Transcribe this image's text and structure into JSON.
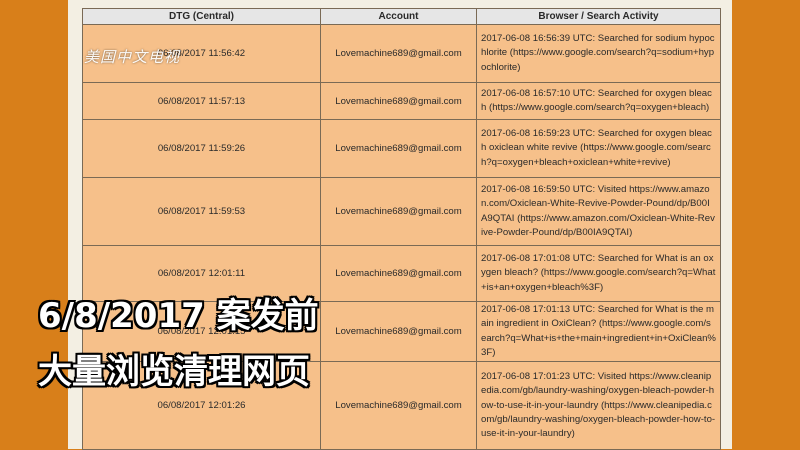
{
  "table": {
    "headers": {
      "dtg": "DTG (Central)",
      "account": "Account",
      "activity": "Browser / Search Activity"
    },
    "rows": [
      {
        "dtg": "06/08/2017 11:56:42",
        "account": "Lovemachine689@gmail.com",
        "activity": "2017-06-08 16:56:39 UTC: Searched for sodium hypochlorite (https://www.google.com/search?q=sodium+hypochlorite)"
      },
      {
        "dtg": "06/08/2017 11:57:13",
        "account": "Lovemachine689@gmail.com",
        "activity": "2017-06-08 16:57:10 UTC: Searched for oxygen bleach (https://www.google.com/search?q=oxygen+bleach)"
      },
      {
        "dtg": "06/08/2017 11:59:26",
        "account": "Lovemachine689@gmail.com",
        "activity": "2017-06-08 16:59:23 UTC: Searched for oxygen bleach oxiclean white revive (https://www.google.com/search?q=oxygen+bleach+oxiclean+white+revive)"
      },
      {
        "dtg": "06/08/2017 11:59:53",
        "account": "Lovemachine689@gmail.com",
        "activity": "2017-06-08 16:59:50 UTC: Visited https://www.amazon.com/Oxiclean-White-Revive-Powder-Pound/dp/B00IA9QTAI (https://www.amazon.com/Oxiclean-White-Revive-Powder-Pound/dp/B00IA9QTAI)"
      },
      {
        "dtg": "06/08/2017 12:01:11",
        "account": "Lovemachine689@gmail.com",
        "activity": "2017-06-08 17:01:08 UTC: Searched for What is an oxygen bleach? (https://www.google.com/search?q=What+is+an+oxygen+bleach%3F)"
      },
      {
        "dtg": "06/08/2017 12:01:15",
        "account": "Lovemachine689@gmail.com",
        "activity": "2017-06-08 17:01:13 UTC: Searched for What is the main ingredient in OxiClean? (https://www.google.com/search?q=What+is+the+main+ingredient+in+OxiClean%3F)"
      },
      {
        "dtg": "06/08/2017 12:01:26",
        "account": "Lovemachine689@gmail.com",
        "activity": "2017-06-08 17:01:23 UTC: Visited https://www.cleanipedia.com/gb/laundry-washing/oxygen-bleach-powder-how-to-use-it-in-your-laundry (https://www.cleanipedia.com/gb/laundry-washing/oxygen-bleach-powder-how-to-use-it-in-your-laundry)"
      }
    ]
  },
  "watermark": "美国中文电视",
  "caption": {
    "line1": "6/8/2017 案发前",
    "line2": "大量浏览清理网页"
  }
}
